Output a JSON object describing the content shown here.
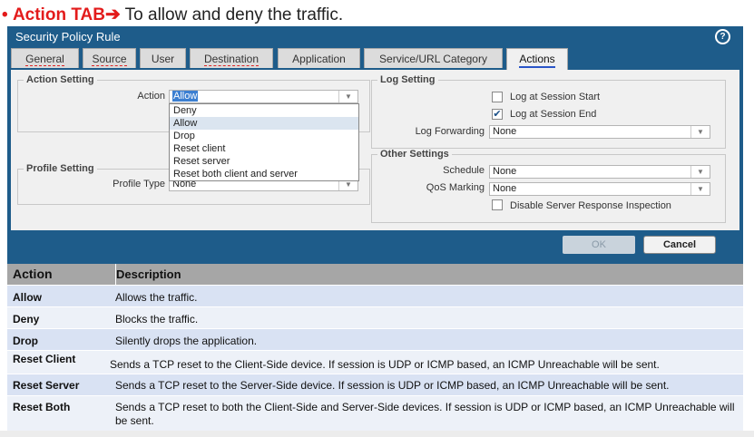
{
  "heading": {
    "bullet": "•",
    "tab": "Action TAB",
    "arrow": "➔",
    "text": "To allow and deny the traffic."
  },
  "dialog": {
    "title": "Security Policy Rule",
    "help_icon": "help-icon",
    "tabs": [
      "General",
      "Source",
      "User",
      "Destination",
      "Application",
      "Service/URL Category",
      "Actions"
    ],
    "active_tab": "Actions",
    "action_setting": {
      "legend": "Action Setting",
      "action_label": "Action",
      "action_value": "Allow",
      "options": [
        "Deny",
        "Allow",
        "Drop",
        "Reset client",
        "Reset server",
        "Reset both client and server"
      ],
      "selected_option": "Allow"
    },
    "profile_setting": {
      "legend": "Profile Setting",
      "profile_type_label": "Profile Type",
      "profile_type_value": "None"
    },
    "log_setting": {
      "legend": "Log Setting",
      "log_start_label": "Log at Session Start",
      "log_start_checked": false,
      "log_end_label": "Log at Session End",
      "log_end_checked": true,
      "log_forwarding_label": "Log Forwarding",
      "log_forwarding_value": "None"
    },
    "other_settings": {
      "legend": "Other Settings",
      "schedule_label": "Schedule",
      "schedule_value": "None",
      "qos_label": "QoS Marking",
      "qos_value": "None",
      "disable_inspection_label": "Disable Server Response Inspection",
      "disable_inspection_checked": false
    },
    "ok_label": "OK",
    "cancel_label": "Cancel"
  },
  "table": {
    "headers": [
      "Action",
      "Description"
    ],
    "rows": [
      {
        "action": "Allow",
        "description": "Allows the traffic."
      },
      {
        "action": "Deny",
        "description": "Blocks the traffic."
      },
      {
        "action": "Drop",
        "description": "Silently drops the application."
      },
      {
        "action": "Reset Client",
        "description": "Sends a TCP reset to the Client-Side device. If session is UDP or ICMP based, an ICMP Unreachable will be sent."
      },
      {
        "action": "Reset Server",
        "description": "Sends a TCP reset to the Server-Side device. If session is UDP or ICMP based, an ICMP Unreachable will be sent."
      },
      {
        "action": "Reset Both",
        "description": "Sends a TCP reset to both the Client-Side and Server-Side devices. If session is UDP or ICMP based, an ICMP Unreachable will be sent."
      }
    ]
  },
  "colors": {
    "accent": "#e31b1b",
    "dialog": "#1e5c8a",
    "header_row": "#a6a6a6",
    "row_even": "#d9e2f3",
    "row_odd": "#edf1f8"
  }
}
